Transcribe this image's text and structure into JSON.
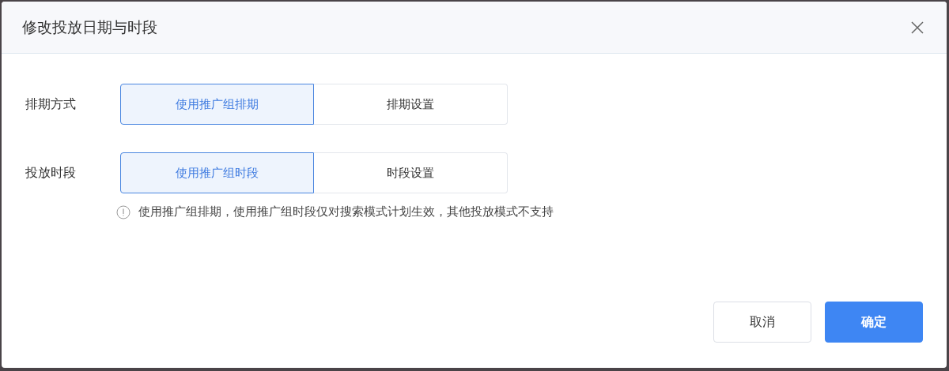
{
  "dialog": {
    "title": "修改投放日期与时段"
  },
  "rows": [
    {
      "label": "排期方式",
      "options": [
        {
          "label": "使用推广组排期",
          "selected": true
        },
        {
          "label": "排期设置",
          "selected": false
        }
      ]
    },
    {
      "label": "投放时段",
      "options": [
        {
          "label": "使用推广组时段",
          "selected": true
        },
        {
          "label": "时段设置",
          "selected": false
        }
      ]
    }
  ],
  "note": "使用推广组排期，使用推广组时段仅对搜索模式计划生效，其他投放模式不支持",
  "buttons": [
    {
      "label": "取消",
      "kind": "secondary"
    },
    {
      "label": "确定",
      "kind": "primary"
    }
  ]
}
